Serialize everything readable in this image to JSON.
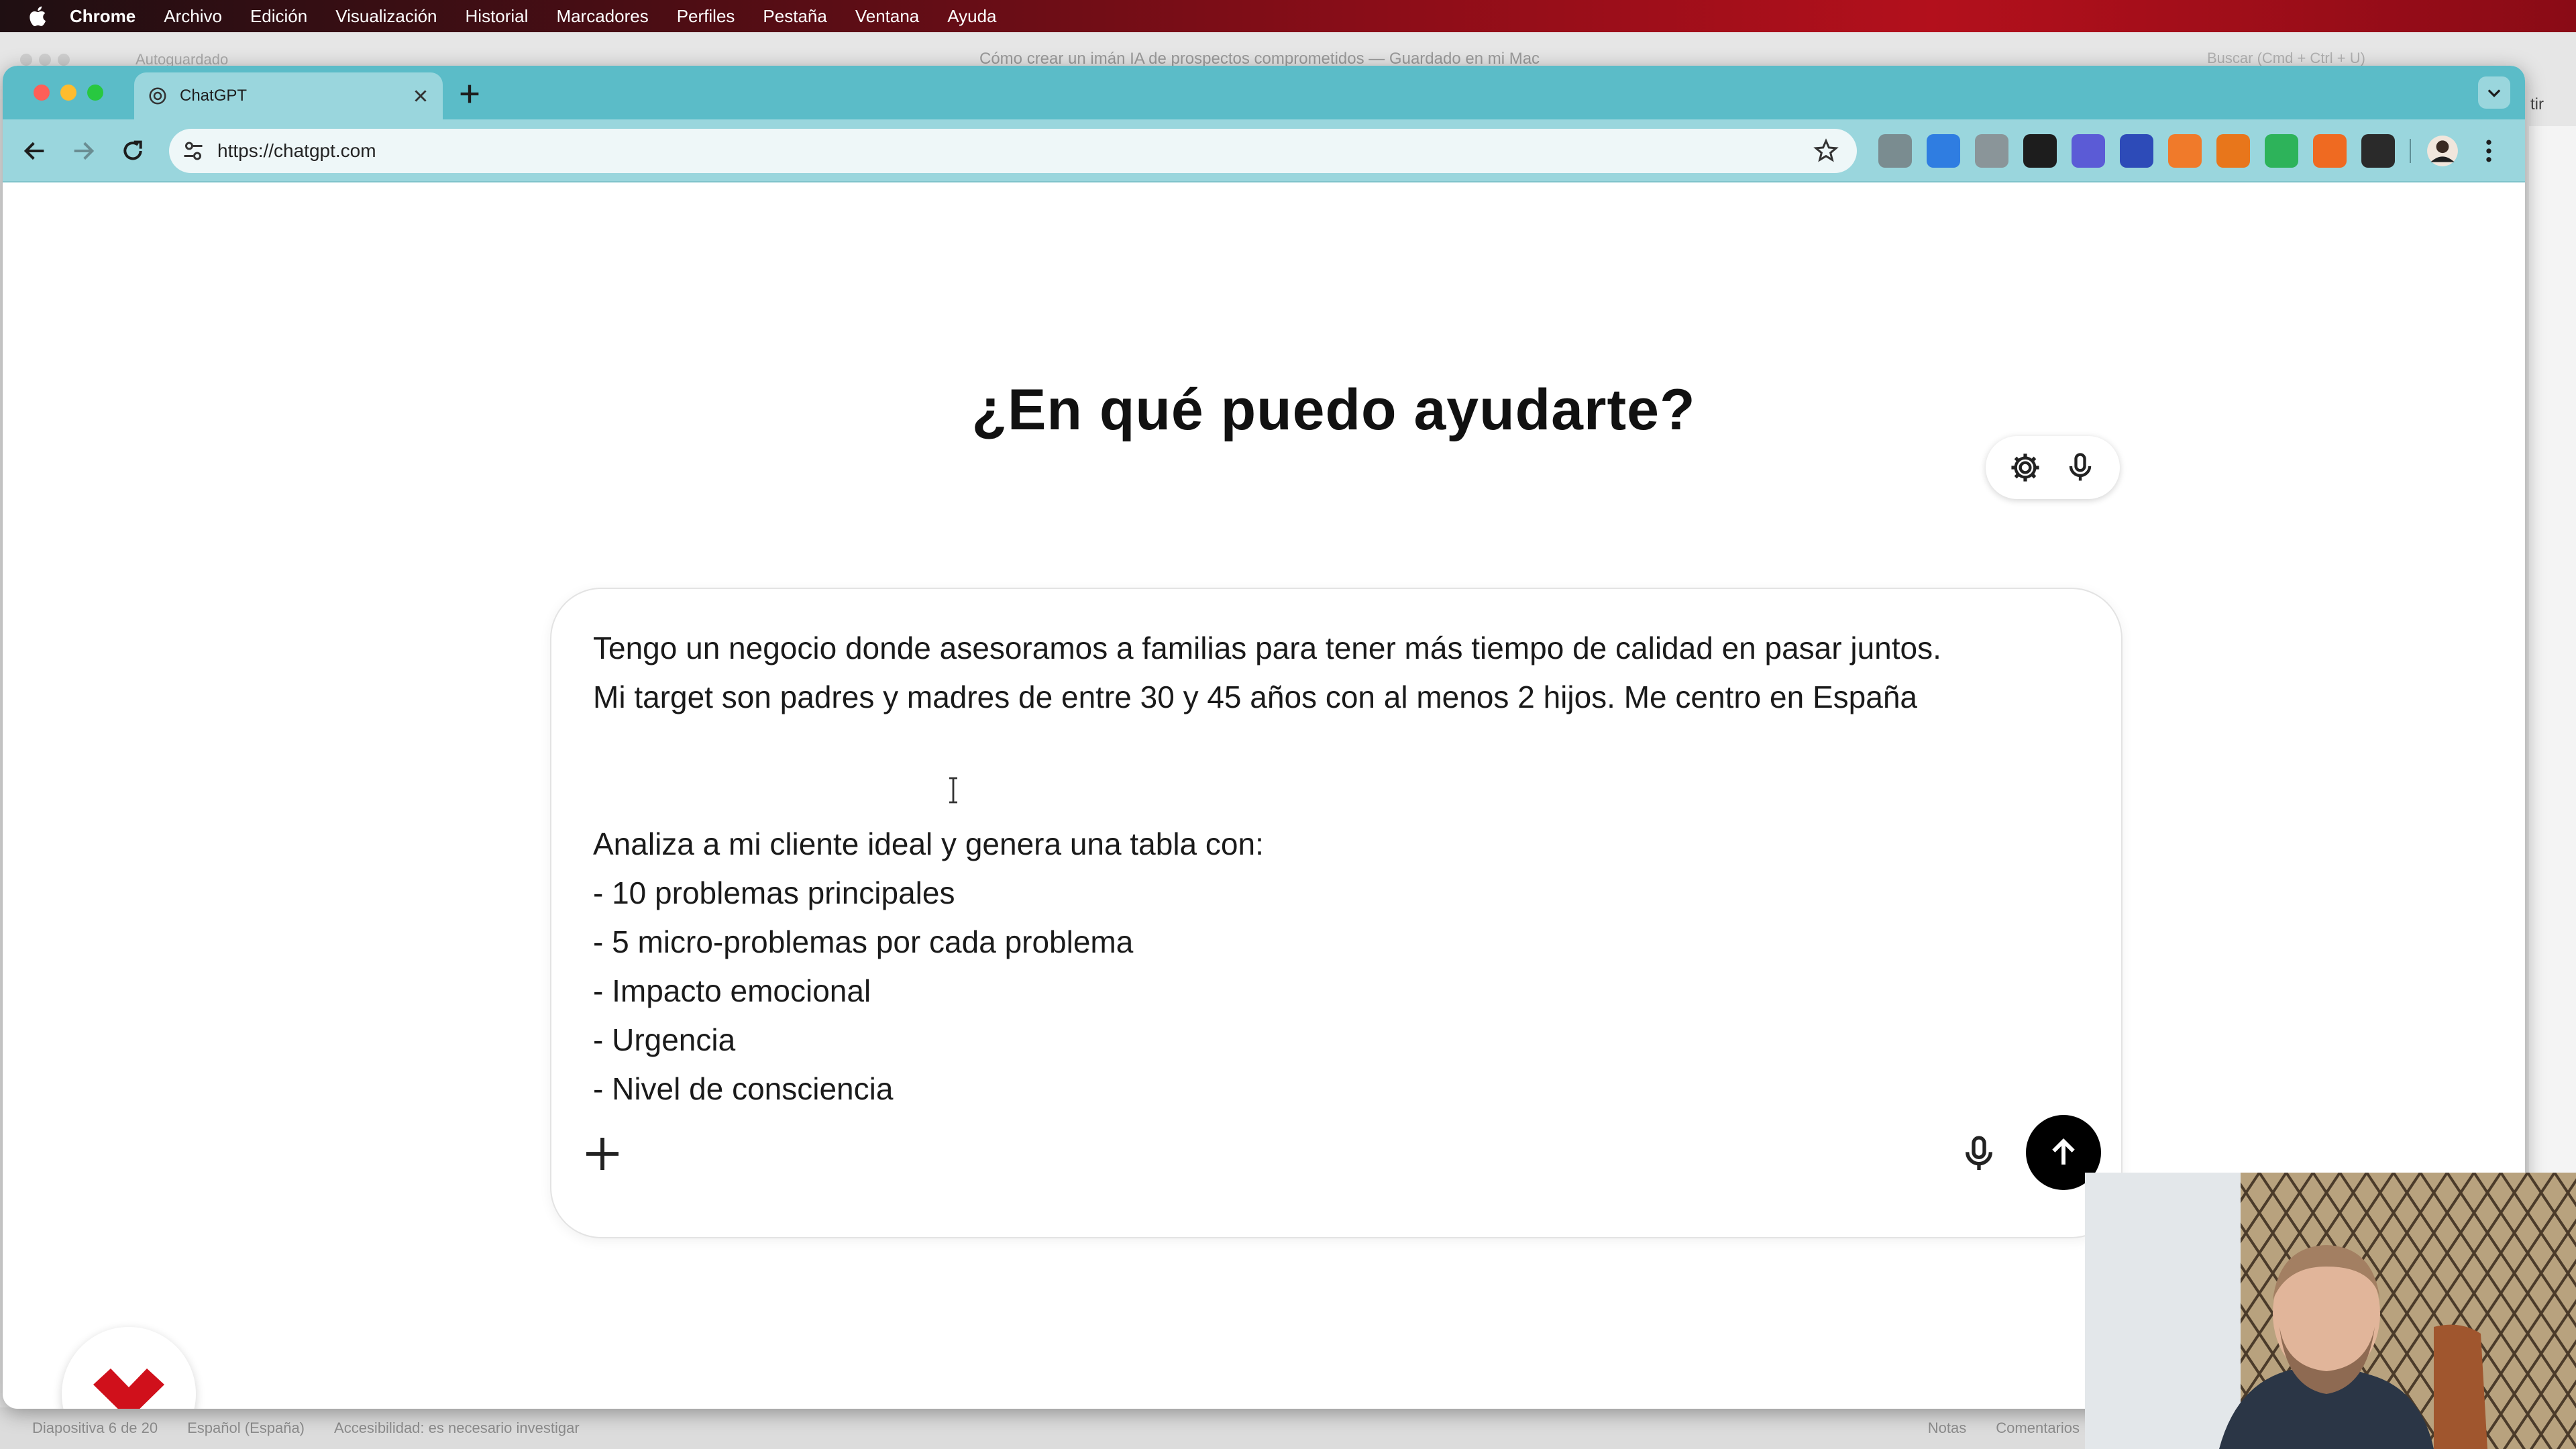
{
  "menubar": {
    "app": "Chrome",
    "items": [
      "Archivo",
      "Edición",
      "Visualización",
      "Historial",
      "Marcadores",
      "Perfiles",
      "Pestaña",
      "Ventana",
      "Ayuda"
    ]
  },
  "background_app": {
    "autosave": "Autoguardado",
    "title": "Cómo crear un imán IA de prospectos comprometidos — Guardado en mi Mac",
    "search": "Buscar (Cmd + Ctrl + U)",
    "side_button": "tir",
    "status_left": [
      "Diapositiva 6 de 20",
      "Español (España)",
      "Accesibilidad: es necesario investigar"
    ],
    "status_right": [
      "Notas",
      "Comentarios"
    ]
  },
  "browser": {
    "tab_title": "ChatGPT",
    "url": "https://chatgpt.com",
    "extensions": [
      {
        "icon": "code-icon",
        "color": "#7a8c90"
      },
      {
        "icon": "tag-icon",
        "color": "#2f7de1"
      },
      {
        "icon": "camera-icon",
        "color": "#8a9599"
      },
      {
        "icon": "k-extension-icon",
        "color": "#1d1d1d"
      },
      {
        "icon": "ai-badge-icon",
        "color": "#5b5bd6"
      },
      {
        "icon": "calendar-badge-icon",
        "color": "#2d4bb8"
      },
      {
        "icon": "zap-icon",
        "color": "#f07a2a"
      },
      {
        "icon": "fox-icon",
        "color": "#e8761b"
      },
      {
        "icon": "record-icon",
        "color": "#2db35a"
      },
      {
        "icon": "flame-icon",
        "color": "#ef6a21"
      },
      {
        "icon": "puzzle-icon",
        "color": "#2a2a2a"
      }
    ]
  },
  "chat": {
    "headline": "¿En qué puedo ayudarte?",
    "prompt_lines": [
      "Tengo un negocio donde asesoramos a familias para tener más tiempo de calidad en pasar juntos.",
      "Mi target son padres y madres de entre 30 y 45 años con al menos 2 hijos. Me centro en España",
      "",
      "",
      "Analiza a mi cliente ideal y genera una tabla con:",
      "- 10 problemas principales",
      "- 5 micro-problemas por cada problema",
      "- Impacto emocional",
      "- Urgencia",
      "- Nivel de consciencia"
    ]
  },
  "colors": {
    "tab_strip": "#5bbcc8",
    "toolbar": "#9ad6dd",
    "send_button": "#000000",
    "logo_red": "#d0101b"
  }
}
